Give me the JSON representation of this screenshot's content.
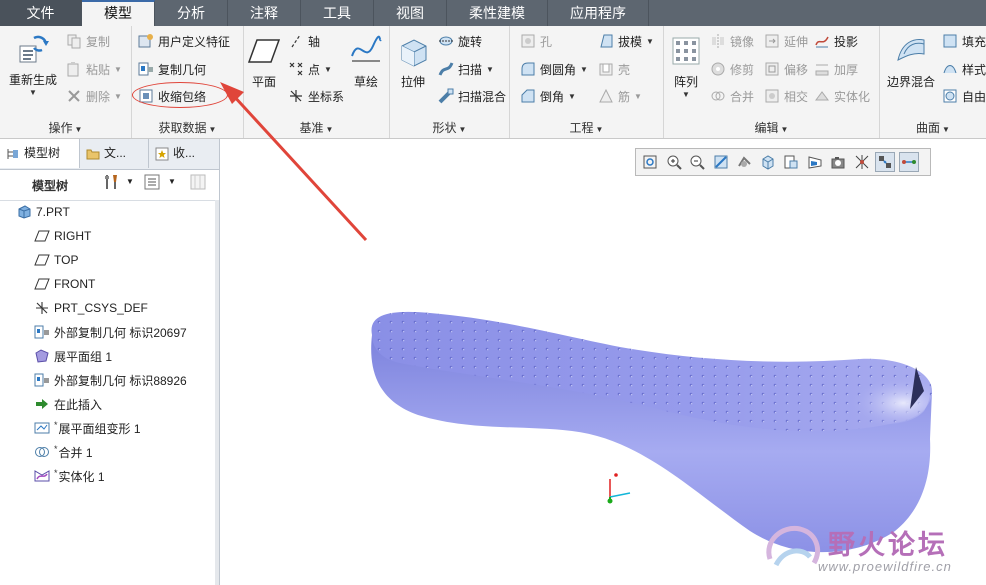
{
  "tabs": [
    {
      "label": "文件"
    },
    {
      "label": "模型"
    },
    {
      "label": "分析"
    },
    {
      "label": "注释"
    },
    {
      "label": "工具"
    },
    {
      "label": "视图"
    },
    {
      "label": "柔性建模"
    },
    {
      "label": "应用程序"
    }
  ],
  "ribbon": {
    "operations": {
      "label": "操作",
      "regenerate": "重新生成",
      "copy": "复制",
      "paste": "粘贴",
      "delete": "删除"
    },
    "get_data": {
      "label": "获取数据",
      "udf": "用户定义特征",
      "copy_geom": "复制几何",
      "shrinkwrap": "收缩包络"
    },
    "datum": {
      "label": "基准",
      "plane": "平面",
      "axis": "轴",
      "point": "点",
      "csys": "坐标系",
      "sketch": "草绘"
    },
    "shapes": {
      "label": "形状",
      "extrude": "拉伸",
      "revolve": "旋转",
      "sweep": "扫描",
      "swept_blend": "扫描混合"
    },
    "engineering": {
      "label": "工程",
      "hole": "孔",
      "draft": "拔模",
      "round": "倒圆角",
      "shell": "壳",
      "chamfer": "倒角",
      "rib": "筋"
    },
    "editing": {
      "label": "编辑",
      "pattern": "阵列",
      "mirror": "镜像",
      "extend": "延伸",
      "project": "投影",
      "trim": "修剪",
      "offset": "偏移",
      "thicken": "加厚",
      "merge": "合并",
      "intersect": "相交",
      "solidify": "实体化"
    },
    "surfaces": {
      "label": "曲面",
      "boundary_blend": "边界混合",
      "fill": "填充",
      "style": "样式",
      "freestyle": "自由"
    }
  },
  "navigator": {
    "tabs": [
      "模型树",
      "文...",
      "收..."
    ],
    "tree_title": "模型树"
  },
  "tree": [
    {
      "label": "7.PRT",
      "icon": "part-icon"
    },
    {
      "label": "RIGHT",
      "icon": "datum-plane-icon"
    },
    {
      "label": "TOP",
      "icon": "datum-plane-icon"
    },
    {
      "label": "FRONT",
      "icon": "datum-plane-icon"
    },
    {
      "label": "PRT_CSYS_DEF",
      "icon": "csys-icon"
    },
    {
      "label": "外部复制几何 标识20697",
      "icon": "copy-geometry-icon"
    },
    {
      "label": "展平面组 1",
      "icon": "flatten-quilt-icon"
    },
    {
      "label": "外部复制几何 标识88926",
      "icon": "copy-geometry-icon"
    },
    {
      "label": "在此插入",
      "icon": "insert-here-arrow-icon"
    },
    {
      "label": "展平面组变形 1",
      "icon": "flatten-deform-icon"
    },
    {
      "label": "合并 1",
      "icon": "merge-icon"
    },
    {
      "label": "实体化 1",
      "icon": "solidify-icon"
    }
  ],
  "watermark": {
    "title": "野火论坛",
    "url": "www.proewildfire.cn"
  },
  "colors": {
    "tabbar": "#5d6670",
    "ribbon": "#f4f4f4",
    "model": "#8f95e8",
    "arrow": "#e0453a"
  }
}
